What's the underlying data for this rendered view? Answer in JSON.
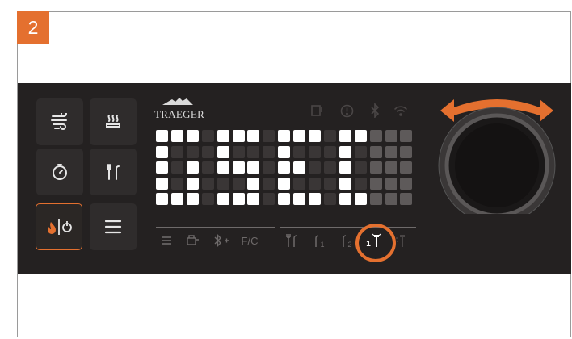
{
  "step": {
    "number": "2"
  },
  "brand": {
    "name": "TRAEGER"
  },
  "colors": {
    "accent": "#e4702f",
    "panel": "#242121",
    "lit": "#ffffff",
    "unlit": "#3a3636",
    "dim": "#5e5a5a"
  },
  "left_buttons": [
    {
      "name": "super-smoke-button",
      "icon": "wind-icon"
    },
    {
      "name": "keep-warm-button",
      "icon": "heat-waves-icon"
    },
    {
      "name": "timer-button",
      "icon": "stopwatch-icon"
    },
    {
      "name": "probe-button",
      "icon": "probe-icon"
    },
    {
      "name": "ignite-shutdown-button",
      "icon": "flame-power-icon",
      "active": true
    },
    {
      "name": "menu-button",
      "icon": "menu-icon"
    }
  ],
  "status_icons": [
    "pellet-icon",
    "alert-icon",
    "bluetooth-icon",
    "wifi-icon"
  ],
  "bottom_left": {
    "temp_unit": "F/C"
  },
  "bottom_right": {
    "probe1_label": "1",
    "probe2_label": "2",
    "selected_label": "1"
  },
  "dot_matrix": {
    "rows": 5,
    "cols": 17,
    "lit_rows": [
      "11101110111011000",
      "10001000100010000",
      "10101110110010000",
      "10100010100010000",
      "11101110111011000"
    ],
    "dim_rows": [
      "00000000000000111",
      "00000000000000111",
      "00000000000000111",
      "00000000000000111",
      "00000000000000111"
    ]
  }
}
